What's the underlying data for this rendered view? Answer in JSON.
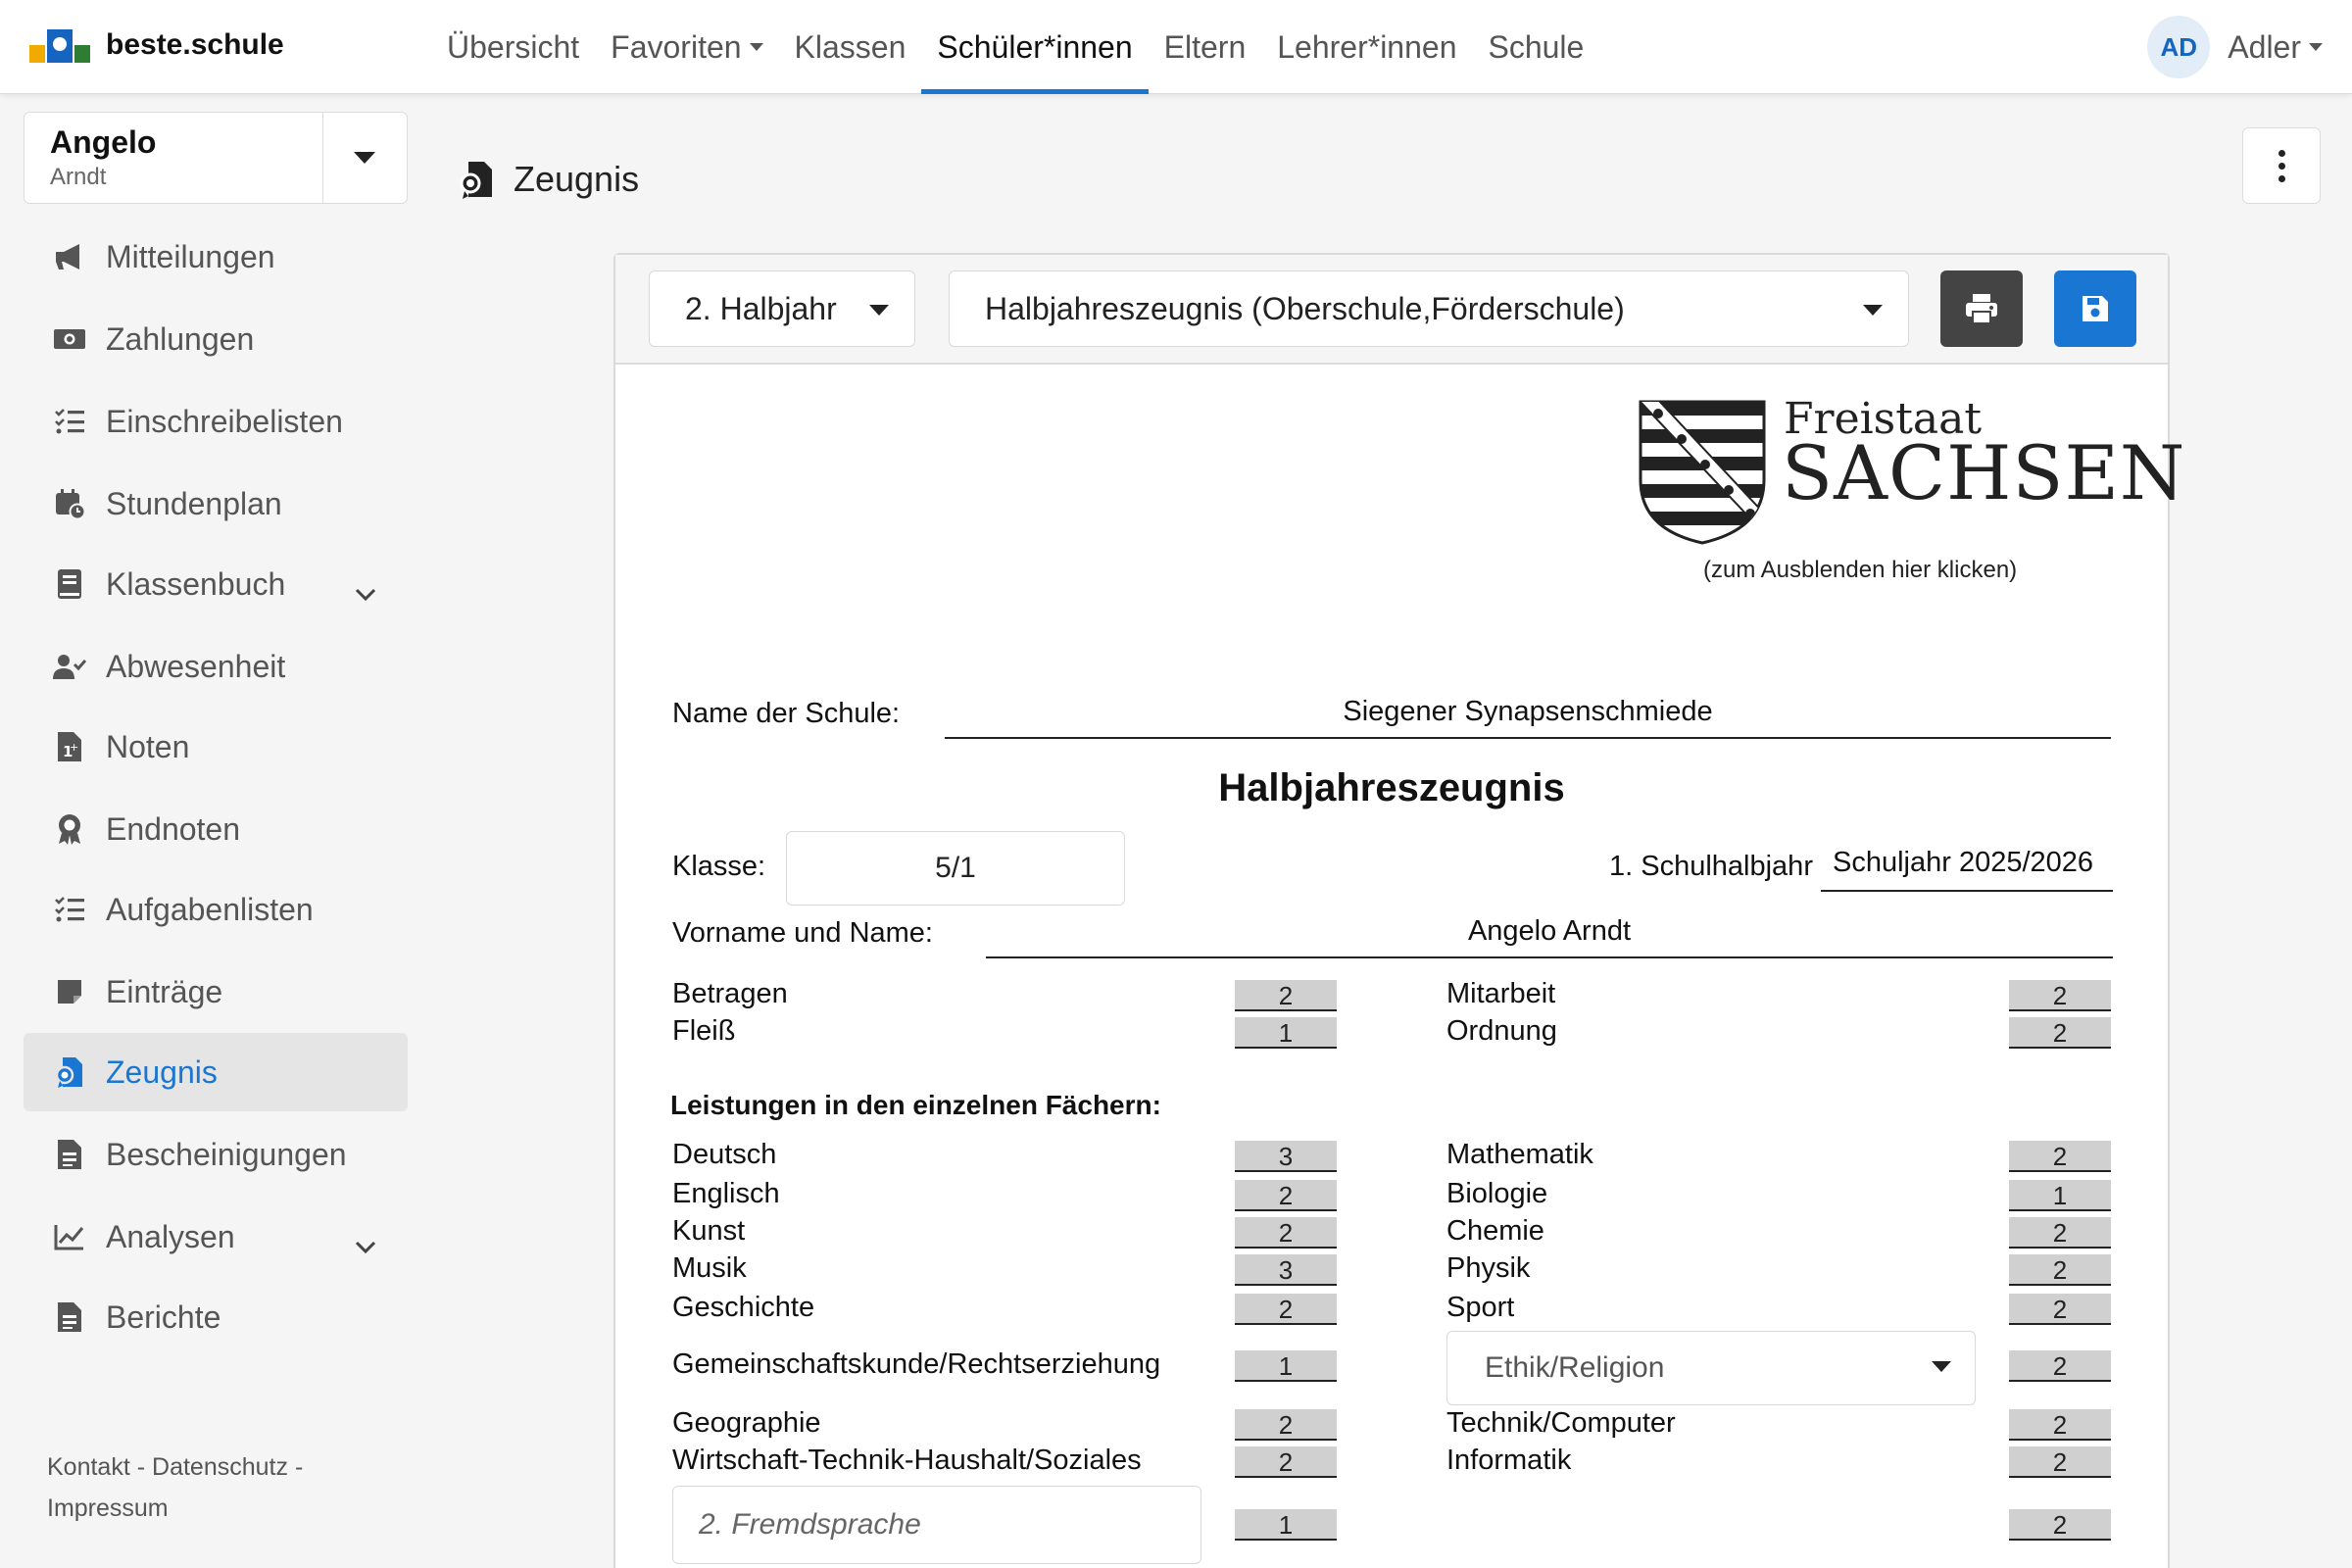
{
  "brand": {
    "name": "beste.schule"
  },
  "nav": {
    "items": [
      {
        "label": "Übersicht",
        "dropdown": false,
        "active": false
      },
      {
        "label": "Favoriten",
        "dropdown": true,
        "active": false
      },
      {
        "label": "Klassen",
        "dropdown": false,
        "active": false
      },
      {
        "label": "Schüler*innen",
        "dropdown": false,
        "active": true
      },
      {
        "label": "Eltern",
        "dropdown": false,
        "active": false
      },
      {
        "label": "Lehrer*innen",
        "dropdown": false,
        "active": false
      },
      {
        "label": "Schule",
        "dropdown": false,
        "active": false
      }
    ]
  },
  "user": {
    "initials": "AD",
    "name": "Adler"
  },
  "student": {
    "first_name": "Angelo",
    "last_name": "Arndt"
  },
  "sidebar": {
    "items": [
      {
        "label": "Mitteilungen",
        "icon": "megaphone-icon"
      },
      {
        "label": "Zahlungen",
        "icon": "money-icon"
      },
      {
        "label": "Einschreibelisten",
        "icon": "checklist-icon"
      },
      {
        "label": "Stundenplan",
        "icon": "calendar-clock-icon"
      },
      {
        "label": "Klassenbuch",
        "icon": "book-icon",
        "expandable": true
      },
      {
        "label": "Abwesenheit",
        "icon": "user-check-icon"
      },
      {
        "label": "Noten",
        "icon": "grade-file-icon"
      },
      {
        "label": "Endnoten",
        "icon": "award-icon"
      },
      {
        "label": "Aufgabenlisten",
        "icon": "checklist-icon"
      },
      {
        "label": "Einträge",
        "icon": "note-icon"
      },
      {
        "label": "Zeugnis",
        "icon": "certificate-icon",
        "active": true
      },
      {
        "label": "Bescheinigungen",
        "icon": "document-icon"
      },
      {
        "label": "Analysen",
        "icon": "chart-line-icon",
        "expandable": true
      },
      {
        "label": "Berichte",
        "icon": "document-icon"
      }
    ],
    "footer": {
      "contact": "Kontakt",
      "privacy": "Datenschutz",
      "imprint": "Impressum",
      "separator": "-"
    }
  },
  "page": {
    "title": "Zeugnis"
  },
  "toolbar": {
    "term_select": "2. Halbjahr",
    "template_select": "Halbjahreszeugnis (Oberschule,Förderschule)",
    "print_icon": "print-icon",
    "save_icon": "save-icon"
  },
  "certificate": {
    "logo_line1": "Freistaat",
    "logo_line2": "SACHSEN",
    "logo_hint": "(zum Ausblenden hier klicken)",
    "school_label": "Name der Schule:",
    "school_name": "Siegener Synapsenschmiede",
    "title": "Halbjahreszeugnis",
    "class_label": "Klasse:",
    "class_value": "5/1",
    "term_label": "1. Schulhalbjahr",
    "school_year": "Schuljahr 2025/2026",
    "name_label": "Vorname und Name:",
    "student_name": "Angelo Arndt",
    "behavior": {
      "left": [
        {
          "subject": "Betragen",
          "grade": "2"
        },
        {
          "subject": "Fleiß",
          "grade": "1"
        }
      ],
      "right": [
        {
          "subject": "Mitarbeit",
          "grade": "2"
        },
        {
          "subject": "Ordnung",
          "grade": "2"
        }
      ]
    },
    "subjects_heading": "Leistungen in den einzelnen Fächern:",
    "subjects_left": [
      {
        "subject": "Deutsch",
        "grade": "3"
      },
      {
        "subject": "Englisch",
        "grade": "2"
      },
      {
        "subject": "Kunst",
        "grade": "2"
      },
      {
        "subject": "Musik",
        "grade": "3"
      },
      {
        "subject": "Geschichte",
        "grade": "2"
      },
      {
        "subject": "Gemeinschaftskunde/Rechtserziehung",
        "grade": "1"
      },
      {
        "subject": "Geographie",
        "grade": "2"
      },
      {
        "subject": "Wirtschaft-Technik-Haushalt/Soziales",
        "grade": "2"
      },
      {
        "subject_placeholder": "2. Fremdsprache",
        "grade": "1"
      }
    ],
    "subjects_right": [
      {
        "subject": "Mathematik",
        "grade": "2"
      },
      {
        "subject": "Biologie",
        "grade": "1"
      },
      {
        "subject": "Chemie",
        "grade": "2"
      },
      {
        "subject": "Physik",
        "grade": "2"
      },
      {
        "subject": "Sport",
        "grade": "2"
      },
      {
        "subject_select": "Ethik/Religion",
        "grade": "2"
      },
      {
        "subject": "Technik/Computer",
        "grade": "2"
      },
      {
        "subject": "Informatik",
        "grade": "2"
      },
      {
        "subject": "",
        "grade": "2"
      }
    ]
  }
}
